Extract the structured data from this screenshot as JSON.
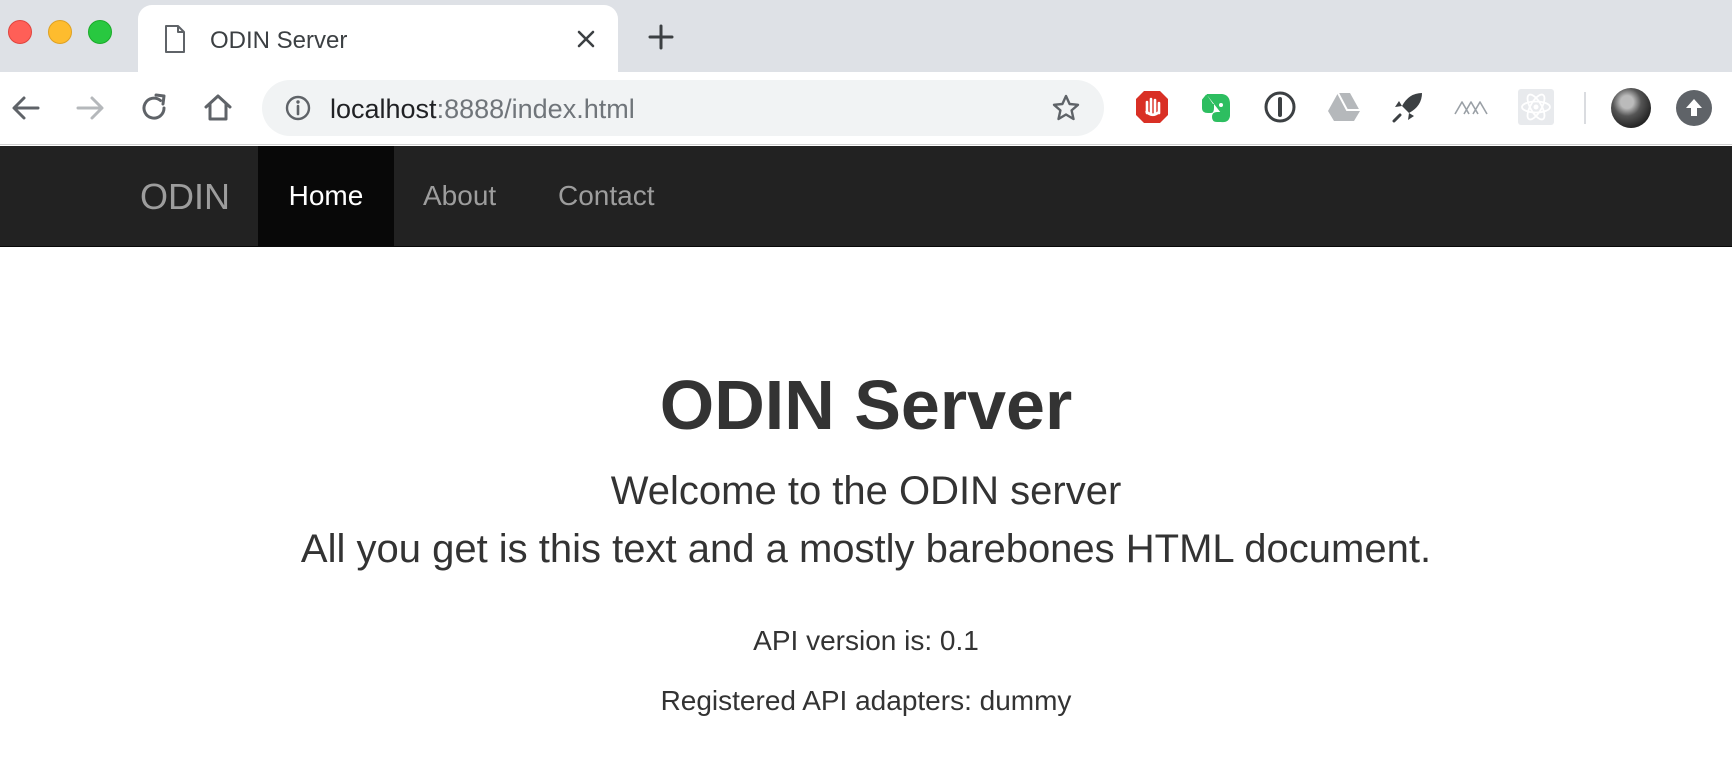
{
  "browser": {
    "tab_title": "ODIN Server",
    "url_host": "localhost",
    "url_path": ":8888/index.html",
    "icons": {
      "back": "arrow-left-icon",
      "forward": "arrow-right-icon",
      "reload": "reload-icon",
      "home": "home-icon",
      "info": "info-circle-icon",
      "bookmark": "star-icon",
      "new_tab": "plus-icon",
      "close_tab": "close-icon"
    },
    "extensions": [
      "adblock-hand-icon",
      "evernote-elephant-icon",
      "1password-icon",
      "google-drive-icon",
      "rocket-icon",
      "mountains-icon",
      "react-atom-icon"
    ],
    "colors": {
      "traffic_close": "#ff5f57",
      "traffic_min": "#febc2e",
      "traffic_max": "#28c840"
    }
  },
  "site": {
    "brand": "ODIN",
    "nav": [
      {
        "label": "Home",
        "active": true
      },
      {
        "label": "About",
        "active": false
      },
      {
        "label": "Contact",
        "active": false
      }
    ],
    "colors": {
      "navbar_bg": "#222222",
      "active_bg": "#080808"
    }
  },
  "content": {
    "title": "ODIN Server",
    "lead_line1": "Welcome to the ODIN server",
    "lead_line2": "All you get is this text and a mostly barebones HTML document.",
    "api_version": "API version is: 0.1",
    "adapters": "Registered API adapters: dummy"
  }
}
